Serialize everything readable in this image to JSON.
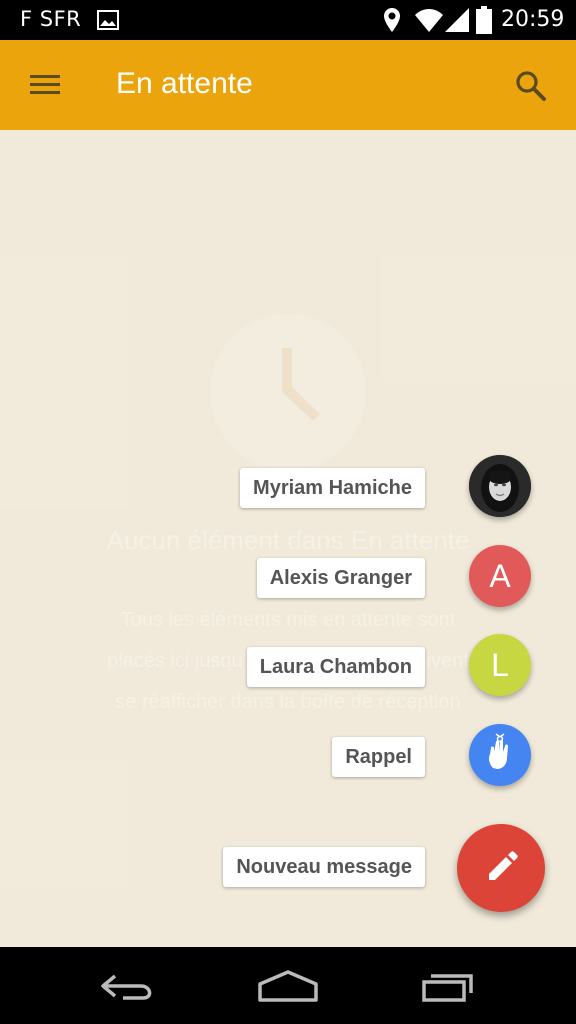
{
  "status_bar": {
    "carrier": "F SFR",
    "time": "20:59"
  },
  "app_bar": {
    "title": "En attente",
    "icons": [
      "menu-icon",
      "search-icon"
    ]
  },
  "empty_state": {
    "icon": "clock-icon",
    "title": "Aucun élément dans En attente",
    "body": "Tous les éléments mis en attente sont placés ici jusqu'au moment où ils doivent se réafficher dans la boîte de réception"
  },
  "speed_dial": {
    "items": [
      {
        "label": "Myriam Hamiche",
        "type": "photo",
        "color": "#3a3a3a"
      },
      {
        "label": "Alexis Granger",
        "type": "letter",
        "letter": "A",
        "color": "#E15A59"
      },
      {
        "label": "Laura Chambon",
        "type": "letter",
        "letter": "L",
        "color": "#C6D741"
      },
      {
        "label": "Rappel",
        "type": "icon",
        "icon": "reminder-hand-icon",
        "color": "#4485F2"
      }
    ],
    "main": {
      "label": "Nouveau message",
      "icon": "pencil-icon",
      "color": "#DB4437"
    }
  },
  "colors": {
    "app_bar": "#EBA40C",
    "background": "#F2EADB"
  }
}
